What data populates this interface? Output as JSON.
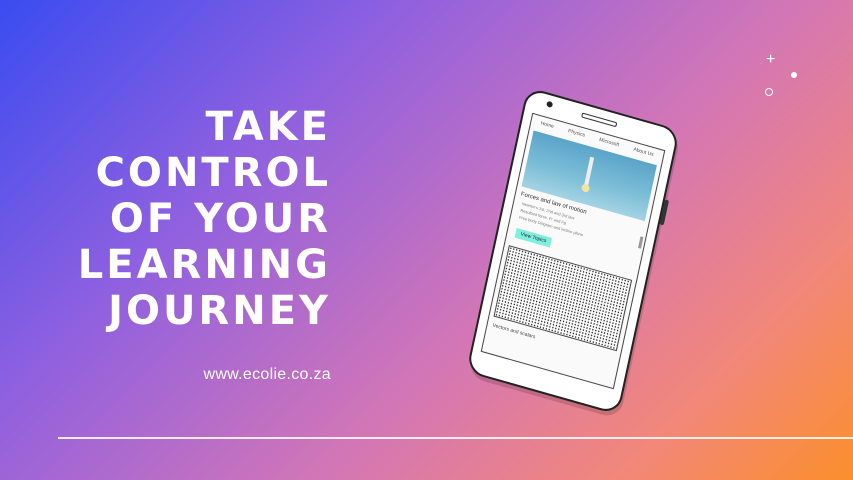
{
  "headline": {
    "line1": "TAKE",
    "line2": "CONTROL",
    "line3": "OF YOUR",
    "line4": "LEARNING",
    "line5": "JOURNEY"
  },
  "url": "www.ecolie.co.za",
  "deco": {
    "plus": "+"
  },
  "phone": {
    "nav": [
      "Home",
      "Physics",
      "Microsoft",
      "About Us"
    ],
    "section_title": "Forces and law of motion",
    "lines": [
      "Newton's 1st, 2nd and 3rd law",
      "Resultant force, Fr and Fg",
      "Free body Diagram and incline plane"
    ],
    "button_label": "View Topics",
    "footer_text": "Vectors and scalars"
  },
  "colors": {
    "gradient_start": "#3a4cf0",
    "gradient_mid": "#d376b6",
    "gradient_end": "#fb8f2c",
    "text": "#ffffff"
  }
}
